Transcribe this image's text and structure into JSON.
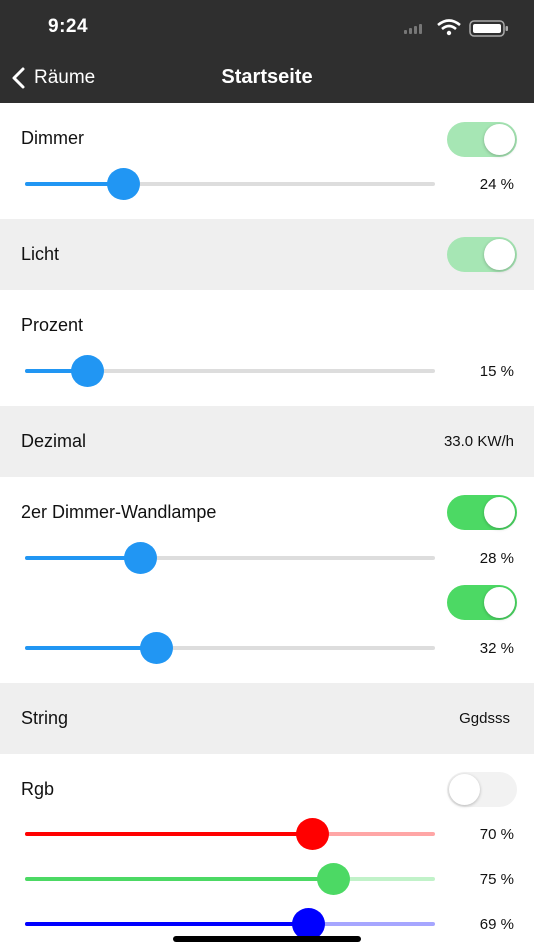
{
  "status_bar": {
    "time": "9:24"
  },
  "nav": {
    "back_label": "Räume",
    "title": "Startseite"
  },
  "rows": {
    "dimmer": {
      "label": "Dimmer",
      "switch_on": true,
      "level": 24,
      "level_text": "24 %"
    },
    "licht": {
      "label": "Licht",
      "switch_on": true
    },
    "prozent": {
      "label": "Prozent",
      "level": 15,
      "level_text": "15 %"
    },
    "dezimal": {
      "label": "Dezimal",
      "value": "33.0 KW/h"
    },
    "wandlampe": {
      "label": "2er Dimmer-Wandlampe",
      "channel1": {
        "switch_on": true,
        "level": 28,
        "level_text": "28 %"
      },
      "channel2": {
        "switch_on": true,
        "level": 32,
        "level_text": "32 %"
      }
    },
    "string": {
      "label": "String",
      "value": "Ggdsss"
    },
    "rgb": {
      "label": "Rgb",
      "switch_on": false,
      "red": {
        "level": 70,
        "level_text": "70 %",
        "color": "#ff0000"
      },
      "green": {
        "level": 75,
        "level_text": "75 %",
        "color": "#4cd964"
      },
      "blue": {
        "level": 69,
        "level_text": "69 %",
        "color": "#0000ff"
      }
    }
  },
  "colors": {
    "nav_bg": "#2f2f2f",
    "slider_blue": "#2196f3",
    "switch_on": "#4cd964",
    "switch_on_light": "#a6e6b4",
    "section_gray": "#efefef"
  }
}
